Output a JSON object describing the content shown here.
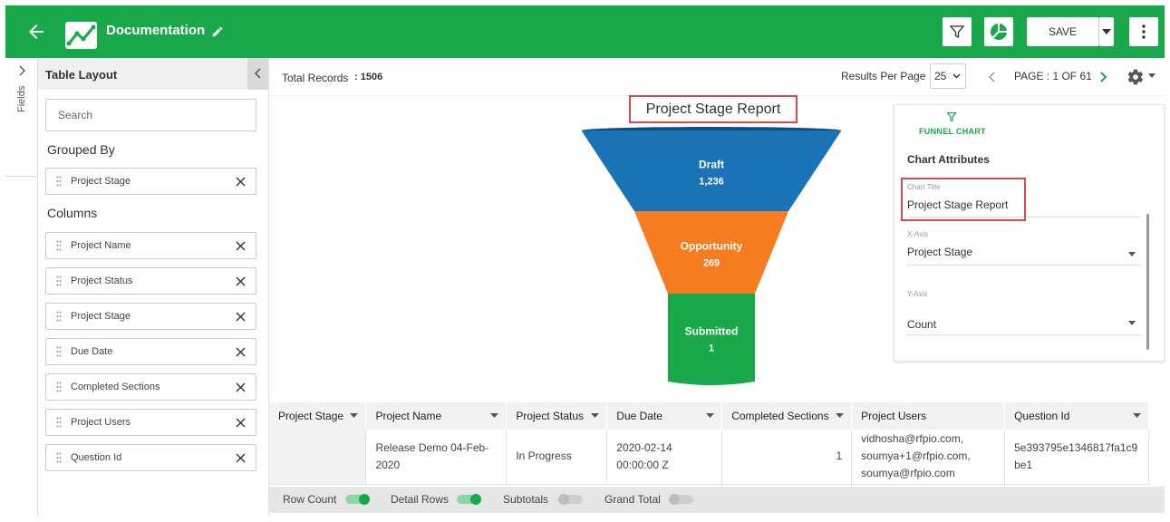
{
  "header": {
    "title": "Documentation",
    "save_label": "SAVE",
    "background_color": "#1aa94a"
  },
  "rail": {
    "label": "Fields"
  },
  "layout_panel": {
    "title": "Table Layout",
    "search_placeholder": "Search",
    "grouped_by_label": "Grouped By",
    "grouped_by": [
      "Project Stage"
    ],
    "columns_label": "Columns",
    "columns": [
      "Project Name",
      "Project Status",
      "Project Stage",
      "Due Date",
      "Completed Sections",
      "Project Users",
      "Question Id"
    ]
  },
  "toolbar": {
    "total_label": "Total Records",
    "total_value": ": 1506",
    "results_per_page_label": "Results Per Page",
    "results_per_page_value": "25",
    "page_label": "PAGE : 1 OF 61"
  },
  "chart_data": {
    "type": "funnel",
    "title": "Project Stage Report",
    "categories": [
      "Draft",
      "Opportunity",
      "Submitted"
    ],
    "values": [
      "1,236",
      "269",
      "1"
    ],
    "colors": [
      "#1a73b5",
      "#f57c1f",
      "#1aa94a"
    ]
  },
  "chart_config": {
    "chart_type_label": "FUNNEL CHART",
    "attributes_label": "Chart Attributes",
    "chart_title_label": "Chart Title",
    "chart_title_value": "Project Stage Report",
    "x_axis_label": "X-Axis",
    "x_axis_value": "Project Stage",
    "y_axis_label": "Y-Axis",
    "y_axis_value": "Count"
  },
  "table": {
    "headers": [
      "Project Stage",
      "Project Name",
      "Project Status",
      "Due Date",
      "Completed Sections",
      "Project Users",
      "Question Id"
    ],
    "rows": [
      {
        "project_stage": "",
        "project_name": "Release Demo 04-Feb-2020",
        "project_status": "In Progress",
        "due_date": "2020-02-14 00:00:00 Z",
        "completed_sections": "1",
        "project_users_1": "vidhosha@rfpio.com,",
        "project_users_2": "soumya+1@rfpio.com,",
        "project_users_3": "soumya@rfpio.com",
        "question_id": "5e393795e1346817fa1c9be1"
      }
    ]
  },
  "footer": {
    "row_count_label": "Row Count",
    "detail_rows_label": "Detail Rows",
    "subtotals_label": "Subtotals",
    "grand_total_label": "Grand Total"
  }
}
